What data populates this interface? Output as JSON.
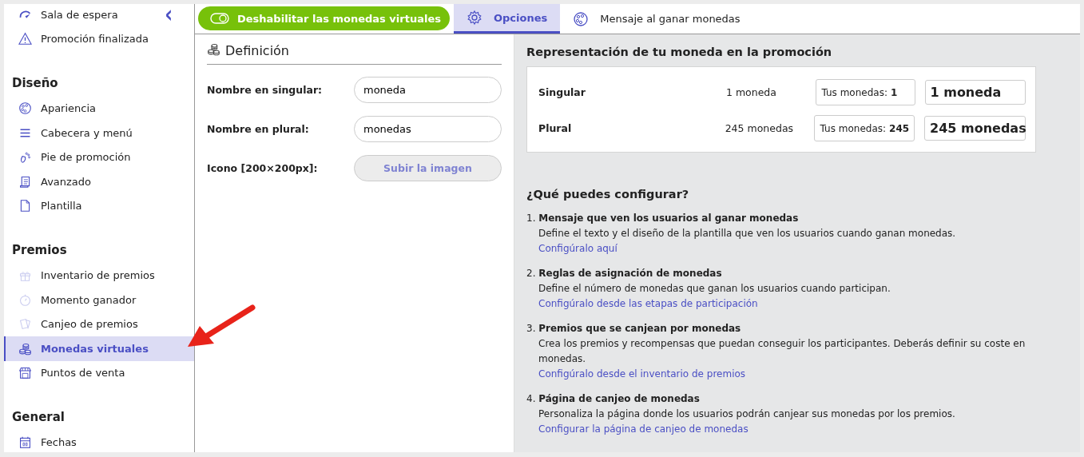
{
  "sidebar": {
    "collapse_button": "‹",
    "top_items": [
      {
        "label": "Sala de espera",
        "selected": false
      },
      {
        "label": "Promoción finalizada",
        "selected": false
      }
    ],
    "sections": [
      {
        "title": "Diseño",
        "items": [
          {
            "label": "Apariencia",
            "selected": false,
            "dimmed": false
          },
          {
            "label": "Cabecera y menú",
            "selected": false,
            "dimmed": false
          },
          {
            "label": "Pie de promoción",
            "selected": false,
            "dimmed": false
          },
          {
            "label": "Avanzado",
            "selected": false,
            "dimmed": false
          },
          {
            "label": "Plantilla",
            "selected": false,
            "dimmed": false
          }
        ]
      },
      {
        "title": "Premios",
        "items": [
          {
            "label": "Inventario de premios",
            "selected": false,
            "dimmed": true
          },
          {
            "label": "Momento ganador",
            "selected": false,
            "dimmed": true
          },
          {
            "label": "Canjeo de premios",
            "selected": false,
            "dimmed": true
          },
          {
            "label": "Monedas virtuales",
            "selected": true,
            "dimmed": false
          },
          {
            "label": "Puntos de venta",
            "selected": false,
            "dimmed": false
          }
        ]
      },
      {
        "title": "General",
        "items": [
          {
            "label": "Fechas",
            "selected": false,
            "dimmed": false
          }
        ]
      }
    ]
  },
  "toolbar": {
    "toggle": {
      "label": "Deshabilitar las monedas virtuales",
      "on": true
    },
    "tabs": [
      {
        "label": "Opciones",
        "selected": true
      },
      {
        "label": "Mensaje al ganar monedas",
        "selected": false
      }
    ]
  },
  "definition": {
    "title": "Definición",
    "fields": [
      {
        "kind": "text",
        "label": "Nombre en singular:",
        "value": "moneda"
      },
      {
        "kind": "text",
        "label": "Nombre en plural:",
        "value": "monedas"
      },
      {
        "kind": "upload",
        "label": "Icono",
        "hint": "[200×200px]:",
        "button": "Subir la imagen",
        "disabled": true
      }
    ]
  },
  "representation": {
    "title": "Representación de tu moneda en la promoción",
    "rows": [
      {
        "name": "Singular",
        "text": "1 moneda",
        "counter_label": "Tus monedas:",
        "counter_value": "1",
        "big": "1 moneda"
      },
      {
        "name": "Plural",
        "text": "245 monedas",
        "counter_label": "Tus monedas:",
        "counter_value": "245",
        "big": "245 monedas"
      }
    ]
  },
  "configure": {
    "title": "¿Qué puedes configurar?",
    "items": [
      {
        "number": "1.",
        "title": "Mensaje que ven los usuarios al ganar monedas",
        "description": "Define el texto y el diseño de la plantilla que ven los usuarios cuando ganan monedas.",
        "link": "Configúralo aquí"
      },
      {
        "number": "2.",
        "title": "Reglas de asignación de monedas",
        "description": "Define el número de monedas que ganan los usuarios cuando participan.",
        "link": "Configúralo desde las etapas de participación"
      },
      {
        "number": "3.",
        "title": "Premios que se canjean por monedas",
        "description": "Crea los premios y recompensas que puedan conseguir los participantes. Deberás definir su coste en monedas.",
        "link": "Configúralo desde el inventario de premios"
      },
      {
        "number": "4.",
        "title": "Página de canjeo de monedas",
        "description": "Personaliza la página donde los usuarios podrán canjear sus monedas por los premios.",
        "link": "Configurar la página de canjeo de monedas"
      }
    ]
  }
}
